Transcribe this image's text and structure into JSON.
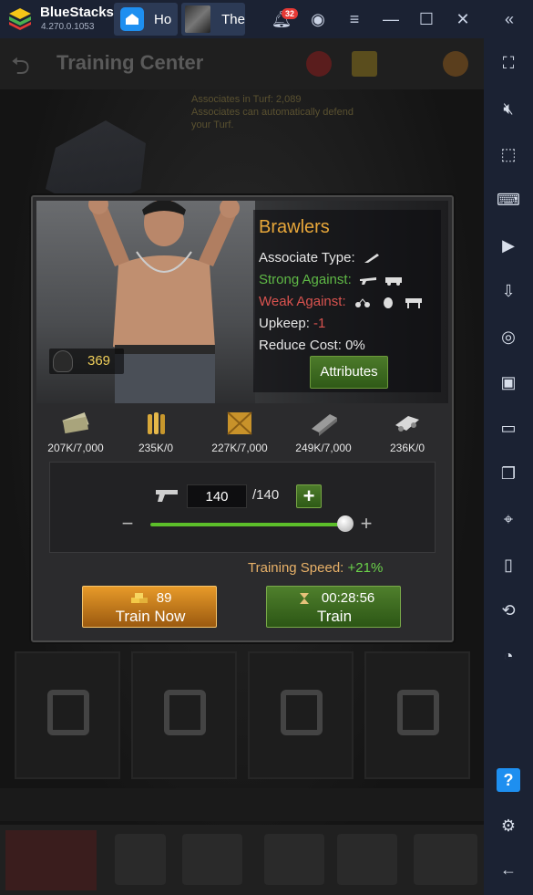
{
  "titlebar": {
    "app_name": "BlueStacks",
    "version": "4.270.0.1053",
    "tabs": [
      {
        "label": "Ho",
        "icon": "home-icon"
      },
      {
        "label": "The",
        "icon": "game-thumbnail-icon"
      }
    ],
    "notification_count": "32"
  },
  "background": {
    "title": "Training Center",
    "info_line1": "Associates in Turf: 2,089",
    "info_line2": "Associates can automatically defend",
    "info_line3": "your Turf."
  },
  "dialog": {
    "unit_name": "Brawlers",
    "associate_type_label": "Associate Type:",
    "strong_against_label": "Strong Against:",
    "weak_against_label": "Weak Against:",
    "upkeep_label": "Upkeep:",
    "upkeep_value": "-1",
    "reduce_cost_label": "Reduce Cost:",
    "reduce_cost_value": "0%",
    "attributes_label": "Attributes",
    "owned_count": "369",
    "resources": [
      {
        "icon": "cash-icon",
        "value": "207K/7,000"
      },
      {
        "icon": "ammo-icon",
        "value": "235K/0"
      },
      {
        "icon": "goods-crate-icon",
        "value": "227K/7,000"
      },
      {
        "icon": "metal-icon",
        "value": "249K/7,000"
      },
      {
        "icon": "cargo-icon",
        "value": "236K/0"
      }
    ],
    "quantity": "140",
    "quantity_max": "/140",
    "slider_fraction": 1.0,
    "training_speed_label": "Training Speed:",
    "training_speed_value": "+21%",
    "train_now_cost": "89",
    "train_now_label": "Train Now",
    "train_time": "00:28:56",
    "train_label": "Train"
  },
  "colors": {
    "strong_against": "#5fb946",
    "weak_against": "#d9534f",
    "title_gold": "#e8a73a"
  }
}
